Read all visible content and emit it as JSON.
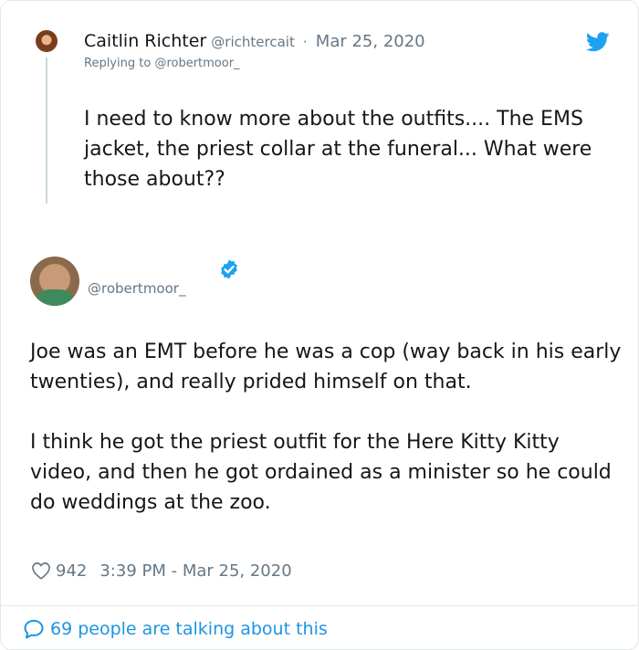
{
  "reply_tweet": {
    "author_name": "Caitlin Richter",
    "author_handle": "@richtercait",
    "separator": "·",
    "date": "Mar 25, 2020",
    "replying_prefix": "Replying to",
    "replying_to": "@robertmoor_",
    "text": "I need to know more about the outfits.... The EMS jacket, the priest collar at the funeral... What were those about??"
  },
  "main_tweet": {
    "author_handle": "@robertmoor_",
    "paragraphs": [
      "Joe was an EMT before he was a cop (way back in his early twenties), and really prided himself on that.",
      "I think he got the priest outfit for the Here Kitty Kitty video, and then he got ordained as a minister so he could do weddings at the zoo."
    ],
    "likes": "942",
    "timestamp": "3:39 PM - Mar 25, 2020"
  },
  "footer": {
    "talking_label": "69 people are talking about this"
  },
  "icons": {
    "bird": "twitter-bird-icon",
    "verified": "verified-badge-icon",
    "heart": "heart-icon",
    "bubble": "speech-bubble-icon"
  },
  "colors": {
    "accent": "#1da1f2",
    "link": "#1b95e0",
    "muted": "#657786",
    "text": "#14171a",
    "border": "#e1e8ed"
  }
}
